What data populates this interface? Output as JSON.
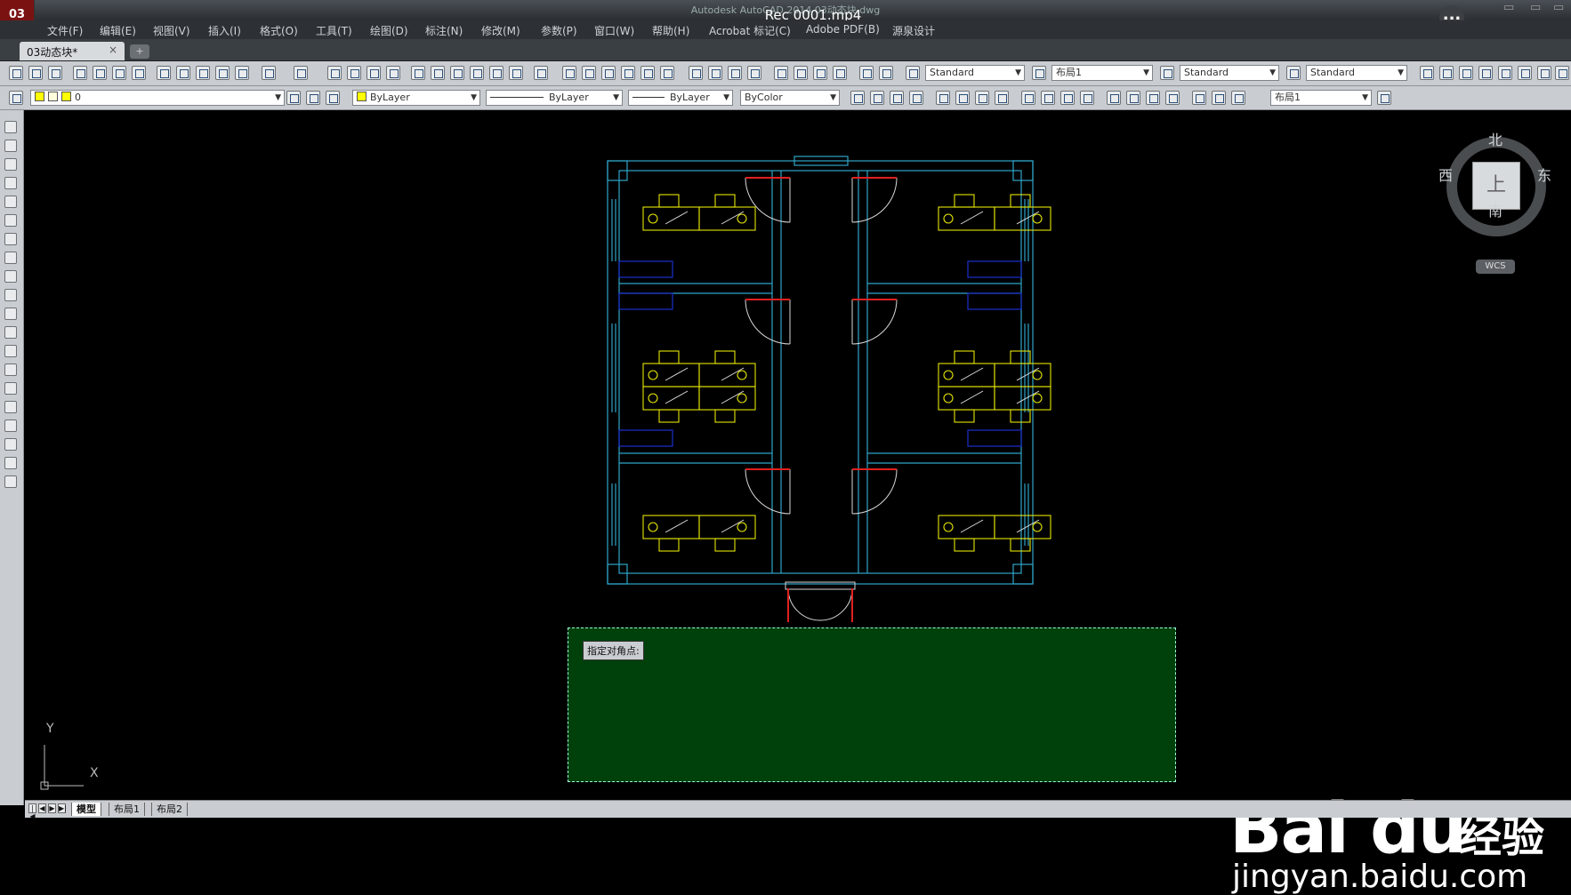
{
  "window": {
    "app_badge": "03",
    "title": "Autodesk AutoCAD 2014 03动态块.dwg",
    "video_title": "Rec 0001.mp4",
    "more_label": "..."
  },
  "menu": [
    "文件(F)",
    "编辑(E)",
    "视图(V)",
    "插入(I)",
    "格式(O)",
    "工具(T)",
    "绘图(D)",
    "标注(N)",
    "修改(M)",
    "参数(P)",
    "窗口(W)",
    "帮助(H)",
    "Acrobat 标记(C)",
    "Adobe PDF(B)",
    "源泉设计"
  ],
  "document_tab": {
    "label": "03动态块*",
    "close": "×",
    "new_tab": "+"
  },
  "toolbar_combos": {
    "text_style": "Standard",
    "dim_layout": "布局1",
    "dim_style": "Standard",
    "table_style": "Standard",
    "layer": "0",
    "color": "ByLayer",
    "linetype": "ByLayer",
    "lineweight": "ByLayer",
    "plot_style": "ByColor",
    "layout2": "布局1"
  },
  "viewcube": {
    "north": "北",
    "south": "南",
    "east": "东",
    "west": "西",
    "top": "上",
    "wcs": "WCS"
  },
  "tooltip": "指定对角点:",
  "ucs": {
    "x": "X",
    "y": "Y"
  },
  "layout_tabs": [
    "模型",
    "布局1",
    "布局2"
  ],
  "watermark": {
    "brand": "Bai du",
    "cn": "经验",
    "url": "jingyan.baidu.com"
  }
}
